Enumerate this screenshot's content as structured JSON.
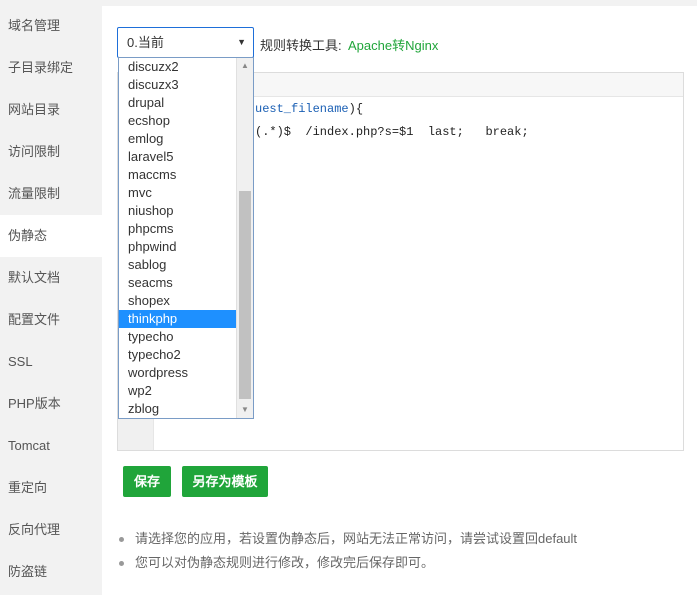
{
  "sidebar": {
    "items": [
      {
        "label": "域名管理"
      },
      {
        "label": "子目录绑定"
      },
      {
        "label": "网站目录"
      },
      {
        "label": "访问限制"
      },
      {
        "label": "流量限制"
      },
      {
        "label": "伪静态"
      },
      {
        "label": "默认文档"
      },
      {
        "label": "配置文件"
      },
      {
        "label": "SSL"
      },
      {
        "label": "PHP版本"
      },
      {
        "label": "Tomcat"
      },
      {
        "label": "重定向"
      },
      {
        "label": "反向代理"
      },
      {
        "label": "防盗链"
      }
    ],
    "active_label": "伪静态"
  },
  "rewrite_select": {
    "value": "0.当前",
    "arrow": "▼"
  },
  "tool": {
    "label": "规则转换工具:",
    "link": "Apache转Nginx"
  },
  "dropdown": {
    "options": [
      "discuzx2",
      "discuzx3",
      "drupal",
      "ecshop",
      "emlog",
      "laravel5",
      "maccms",
      "mvc",
      "niushop",
      "phpcms",
      "phpwind",
      "sablog",
      "seacms",
      "shopex",
      "thinkphp",
      "typecho",
      "typecho2",
      "wordpress",
      "wp2",
      "zblog"
    ],
    "selected": "thinkphp",
    "scroll_up": "▲",
    "scroll_down": "▼"
  },
  "editor": {
    "line1_var": "uest_filename",
    "line1_rest": "){",
    "line2": "(.*)$  /index.php?s=$1  last;   break;"
  },
  "buttons": {
    "save": "保存",
    "save_as_template": "另存为模板"
  },
  "notes": [
    "请选择您的应用，若设置伪静态后，网站无法正常访问，请尝试设置回default",
    "您可以对伪静态规则进行修改，修改完后保存即可。"
  ]
}
